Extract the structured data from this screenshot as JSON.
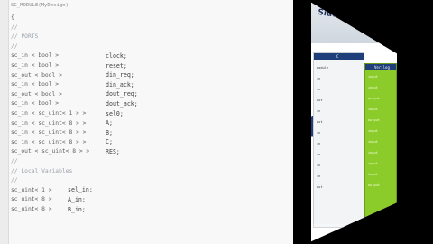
{
  "editor": {
    "first_line": "SC_MODULE(MyDesign)",
    "lines": [
      {
        "text": "{",
        "type": "code"
      },
      {
        "text": "//",
        "type": "comment"
      },
      {
        "text": "// PORTS",
        "type": "comment"
      },
      {
        "text": "//",
        "type": "comment"
      },
      {
        "text": "sc_in < bool >",
        "type": "code"
      },
      {
        "text": "sc_in < bool >",
        "type": "code"
      },
      {
        "text": "sc_out < bool >",
        "type": "code"
      },
      {
        "text": "sc_in < bool >",
        "type": "code"
      },
      {
        "text": "sc_out < bool >",
        "type": "code"
      },
      {
        "text": "sc_in < bool >",
        "type": "code"
      },
      {
        "text": "sc_in < sc_uint< 1 > >",
        "type": "code"
      },
      {
        "text": "sc_in < sc_uint< 8 > >",
        "type": "code"
      },
      {
        "text": "sc_in < sc_uint< 8 > >",
        "type": "code"
      },
      {
        "text": "sc_in < sc_uint< 8 > >",
        "type": "code"
      },
      {
        "text": "sc_out < sc_uint< 8 > >",
        "type": "code"
      },
      {
        "text": "//",
        "type": "comment"
      },
      {
        "text": "// Local Variables",
        "type": "comment"
      },
      {
        "text": "//",
        "type": "comment"
      },
      {
        "text": "sc_uint< 1 >",
        "type": "code"
      },
      {
        "text": "sc_uint< 8 >",
        "type": "code"
      },
      {
        "text": "sc_uint< 8 >",
        "type": "code"
      }
    ],
    "port_names": [
      "clock;",
      "reset;",
      "din_req;",
      "din_ack;",
      "dout_req;",
      "dout_ack;",
      "sel0;",
      "A;",
      "B;",
      "C;",
      "RES;"
    ],
    "var_names": [
      "sel_in;",
      "A_in;",
      "B_in;"
    ]
  },
  "slide": {
    "title": "Side-by-side - Input",
    "left_header": "C",
    "right_header": "Verilog",
    "left_rows": [
      "module",
      "in",
      "in",
      "out",
      "in",
      "out",
      "in",
      "in",
      "in",
      "in",
      "in",
      "out"
    ],
    "right_rows": [
      "input",
      "input",
      "output",
      "input",
      "output",
      "input",
      "input",
      "input",
      "input",
      "input",
      "output"
    ]
  },
  "colors": {
    "slide_green": "#8ccc2a",
    "slide_blue": "#1f3f7a",
    "keyword": "#4a78b8"
  }
}
